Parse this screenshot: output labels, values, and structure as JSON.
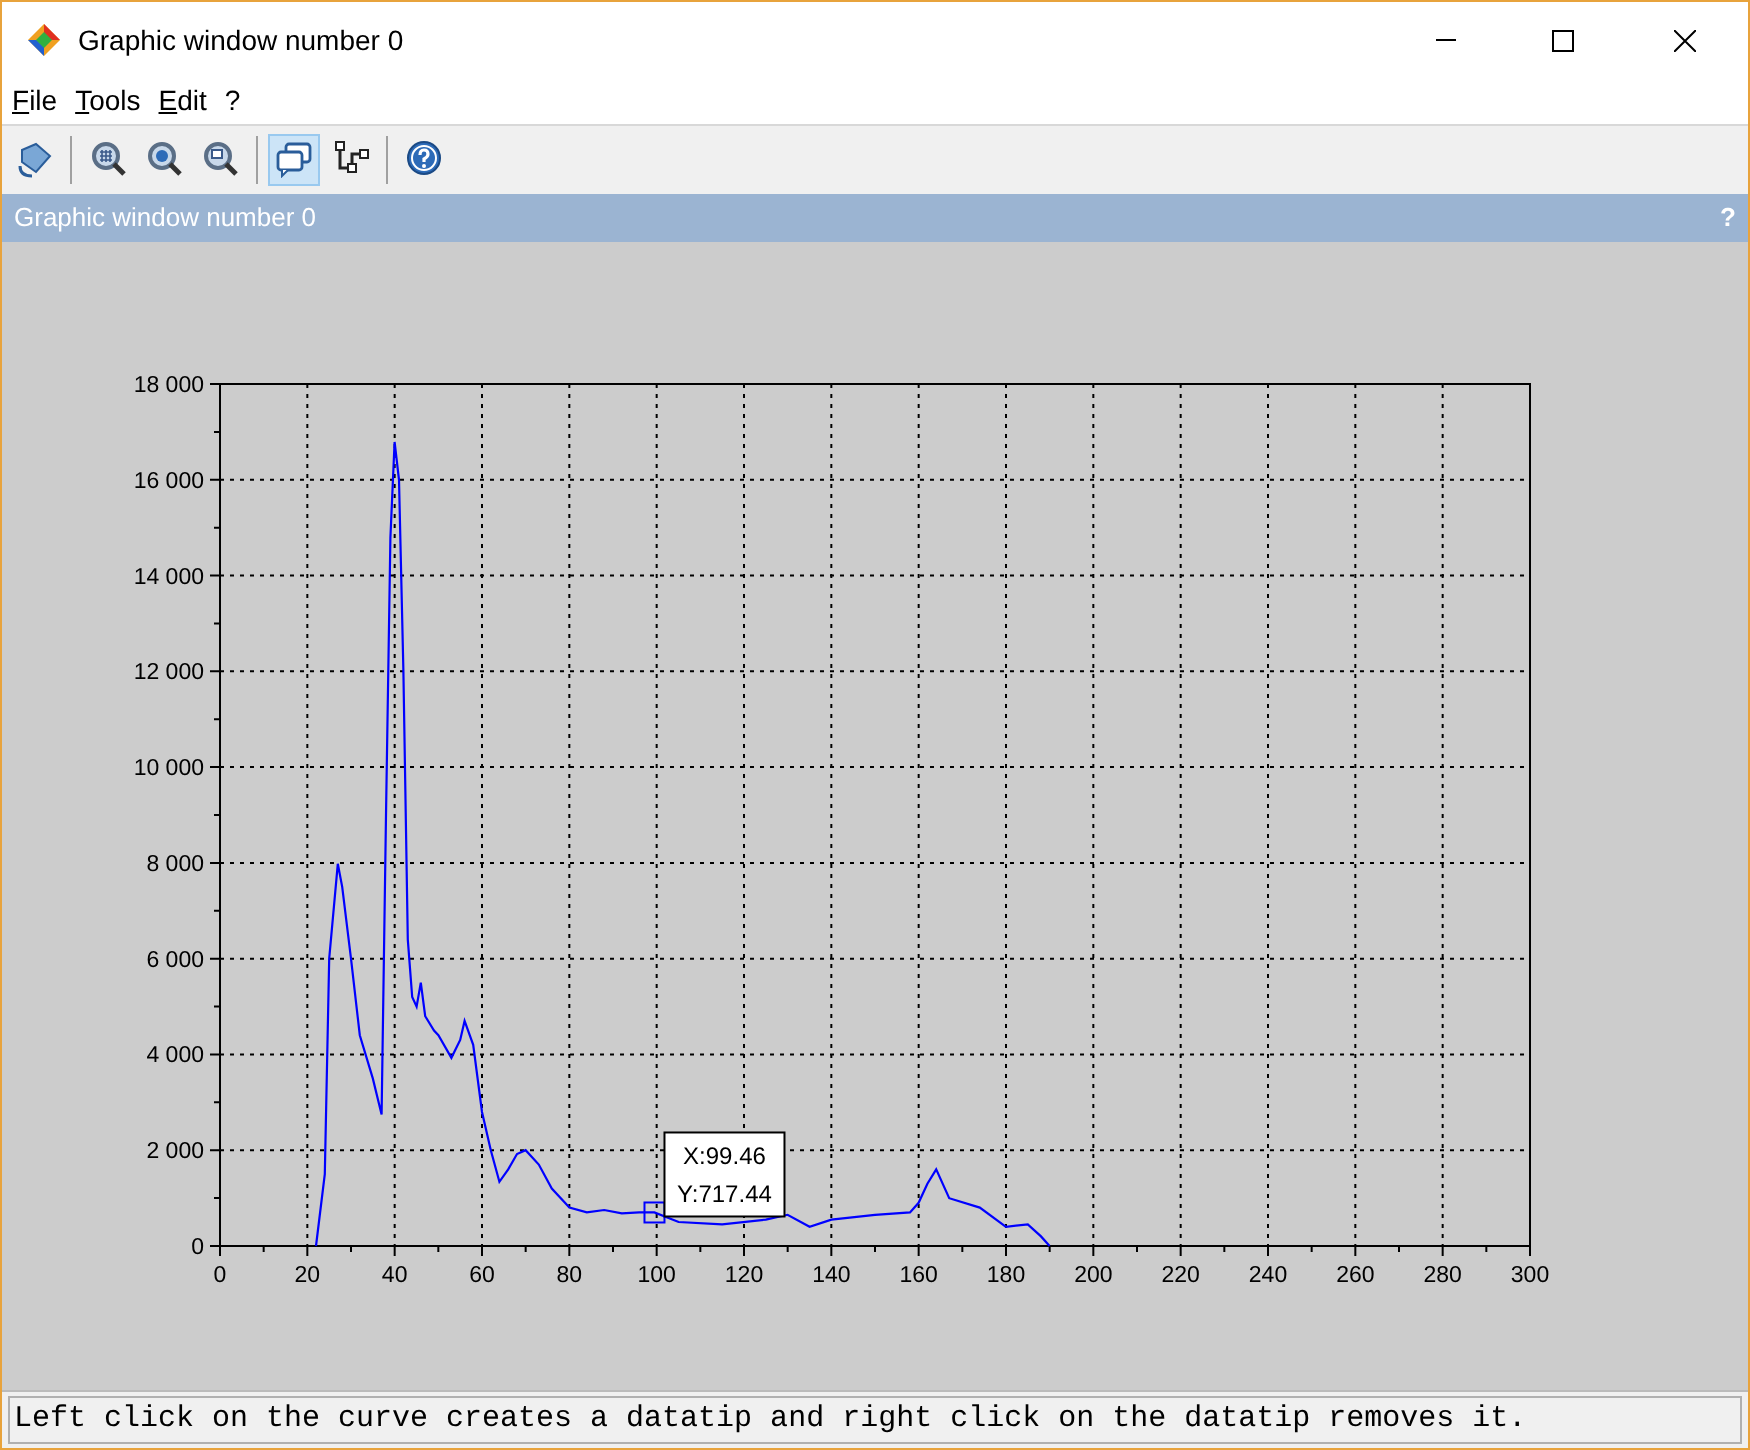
{
  "window": {
    "title": "Graphic window number 0"
  },
  "menu": [
    {
      "label": "File"
    },
    {
      "label": "Tools"
    },
    {
      "label": "Edit"
    },
    {
      "label": "?"
    }
  ],
  "toolbar": [
    [
      {
        "selected": false
      }
    ],
    [
      {
        "selected": false
      },
      {
        "selected": false
      },
      {
        "selected": false
      }
    ],
    [
      {
        "selected": true
      },
      {
        "selected": false
      }
    ],
    [
      {
        "selected": false
      }
    ]
  ],
  "panel": {
    "title": "Graphic window number 0",
    "help": "?"
  },
  "chart_data": {
    "type": "line",
    "grid": true,
    "xlim": [
      0,
      300
    ],
    "ylim": [
      0,
      18000
    ],
    "xticks": [
      0,
      20,
      40,
      60,
      80,
      100,
      120,
      140,
      160,
      180,
      200,
      220,
      240,
      260,
      280,
      300
    ],
    "yticks": [
      {
        "value": 0,
        "label": "0"
      },
      {
        "value": 2000,
        "label": "2 000"
      },
      {
        "value": 4000,
        "label": "4 000"
      },
      {
        "value": 6000,
        "label": "6 000"
      },
      {
        "value": 8000,
        "label": "8 000"
      },
      {
        "value": 10000,
        "label": "10 000"
      },
      {
        "value": 12000,
        "label": "12 000"
      },
      {
        "value": 14000,
        "label": "14 000"
      },
      {
        "value": 16000,
        "label": "16 000"
      },
      {
        "value": 18000,
        "label": "18 000"
      }
    ],
    "x": [
      22,
      24,
      25,
      27,
      28,
      30,
      32,
      35,
      37,
      38,
      39,
      40,
      41,
      42,
      43,
      44,
      45,
      46,
      47,
      49,
      50,
      53,
      55,
      56,
      58,
      60,
      62,
      64,
      66,
      68,
      70,
      73,
      76,
      80,
      84,
      88,
      92,
      96,
      99.5,
      105,
      115,
      125,
      130,
      135,
      140,
      150,
      158,
      160,
      162,
      164,
      167,
      174,
      180,
      185,
      188,
      190
    ],
    "series": [
      {
        "color": "#0000ff",
        "values": [
          0,
          1500,
          6000,
          7980,
          7500,
          6000,
          4400,
          3500,
          2750,
          9000,
          14790,
          16790,
          16000,
          12000,
          6400,
          5200,
          5000,
          5500,
          4800,
          4500,
          4400,
          3930,
          4300,
          4700,
          4200,
          2800,
          2000,
          1340,
          1600,
          1920,
          2000,
          1700,
          1200,
          800,
          700,
          750,
          680,
          700,
          700,
          500,
          450,
          550,
          650,
          400,
          550,
          650,
          700,
          900,
          1300,
          1600,
          1000,
          800,
          400,
          450,
          200,
          0
        ]
      }
    ]
  },
  "datatip": {
    "text": [
      "X:99.46",
      "Y:717.44"
    ]
  },
  "status_bar": "Left click on the curve creates a datatip and right click on the datatip removes it."
}
